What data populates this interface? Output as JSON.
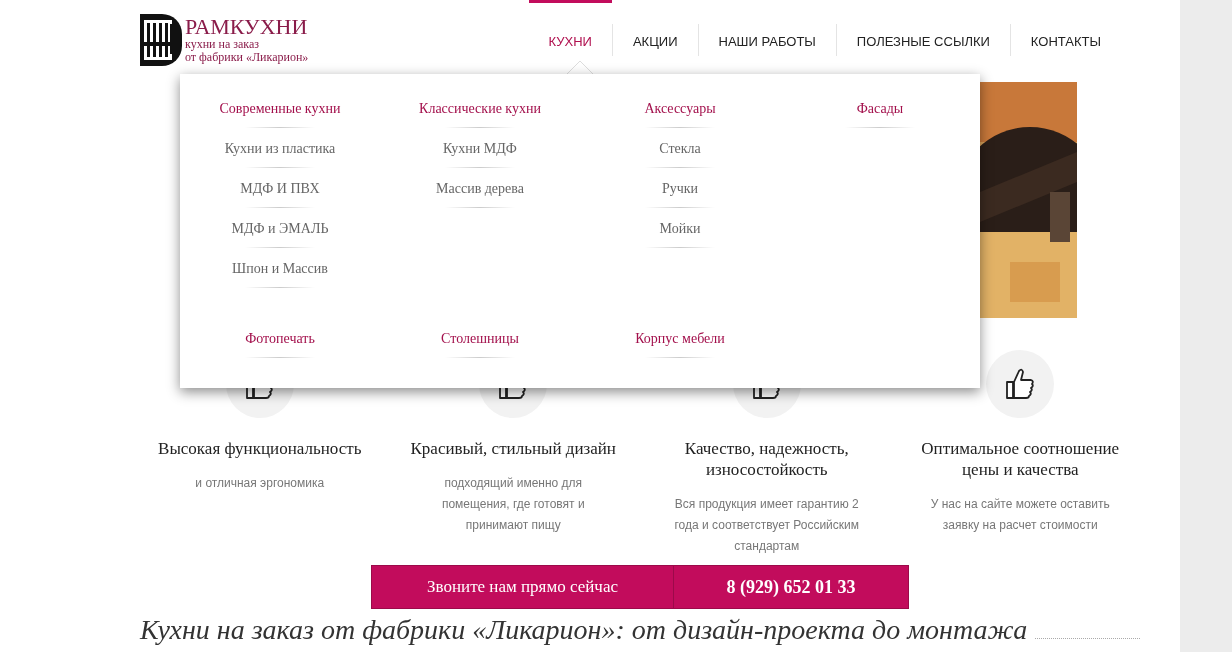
{
  "logo": {
    "title": "РАМКУХНИ",
    "subtitle_1": "кухни на заказ",
    "subtitle_2": "от фабрики «Ликарион»"
  },
  "nav": [
    {
      "label": "КУХНИ",
      "selected": true
    },
    {
      "label": "АКЦИИ",
      "selected": false
    },
    {
      "label": "НАШИ РАБОТЫ",
      "selected": false
    },
    {
      "label": "ПОЛЕЗНЫЕ ССЫЛКИ",
      "selected": false
    },
    {
      "label": "КОНТАКТЫ",
      "selected": false
    }
  ],
  "dropdown": {
    "groups": [
      {
        "heading": "Современные кухни",
        "items": [
          "Кухни из пластика",
          "МДФ И ПВХ",
          "МДФ и ЭМАЛЬ",
          "Шпон и Массив"
        ]
      },
      {
        "heading": "Классические кухни",
        "items": [
          "Кухни МДФ",
          "Массив дерева"
        ]
      },
      {
        "heading": "Аксессуары",
        "items": [
          "Стекла",
          "Ручки",
          "Мойки"
        ]
      },
      {
        "heading": "Фасады"
      }
    ],
    "bottom_headings": [
      "Фотопечать",
      "Столешницы",
      "Корпус мебели"
    ]
  },
  "features": [
    {
      "title": "Высокая функциональность",
      "text": "и отличная эргономика"
    },
    {
      "title": "Красивый, стильный дизайн",
      "text": "подходящий именно для помещения, где готовят и принимают пищу"
    },
    {
      "title": "Качество, надежность, износостойкость",
      "text": "Вся продукция имеет гарантию 2 года и соответствует Российским стандартам"
    },
    {
      "title": "Оптимальное соотношение цены и качества",
      "text": "У нас на сайте можете оставить заявку на расчет стоимости"
    }
  ],
  "call_bar": {
    "label": "Звоните нам прямо сейчас",
    "phone": "8 (929) 652 01 33"
  },
  "headline": "Кухни на заказ от фабрики «Ликарион»: от дизайн-проекта до монтажа"
}
